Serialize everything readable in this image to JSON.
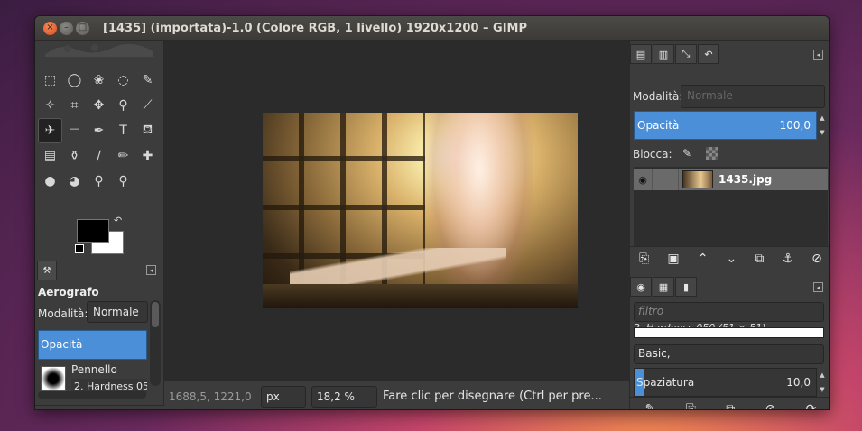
{
  "window": {
    "title": "[1435] (importata)-1.0 (Colore RGB, 1 livello) 1920x1200 – GIMP",
    "close_glyph": "×",
    "min_glyph": "–",
    "max_glyph": "□"
  },
  "toolbox": {
    "tools": [
      {
        "name": "rect-select-icon",
        "glyph": "⬚"
      },
      {
        "name": "ellipse-select-icon",
        "glyph": "◯"
      },
      {
        "name": "free-select-icon",
        "glyph": "❀"
      },
      {
        "name": "fuzzy-select-icon",
        "glyph": "◌"
      },
      {
        "name": "paths-icon",
        "glyph": "✎"
      },
      {
        "name": "magic-wand-icon",
        "glyph": "✧"
      },
      {
        "name": "crop-icon",
        "glyph": "⌗"
      },
      {
        "name": "move-icon",
        "glyph": "✥"
      },
      {
        "name": "color-picker-icon",
        "glyph": "⚲"
      },
      {
        "name": "paintbrush-icon",
        "glyph": "⟋"
      },
      {
        "name": "airbrush-icon",
        "glyph": "✈"
      },
      {
        "name": "eraser-icon",
        "glyph": "▭"
      },
      {
        "name": "ink-icon",
        "glyph": "✒"
      },
      {
        "name": "text-icon",
        "glyph": "T"
      },
      {
        "name": "bucket-fill-icon",
        "glyph": "⛾"
      },
      {
        "name": "gradient-icon",
        "glyph": "▤"
      },
      {
        "name": "clone-icon",
        "glyph": "⚱"
      },
      {
        "name": "smudge-icon",
        "glyph": "∕"
      },
      {
        "name": "pencil-icon",
        "glyph": "✏"
      },
      {
        "name": "heal-icon",
        "glyph": "✚"
      },
      {
        "name": "dodge-burn-icon",
        "glyph": "●"
      },
      {
        "name": "blur-icon",
        "glyph": "◕"
      },
      {
        "name": "zoom-icon",
        "glyph": "⚲"
      },
      {
        "name": "measure-icon",
        "glyph": "⚲"
      }
    ],
    "swap_glyph": "↶",
    "options_tab_glyph": "⚒",
    "panel_menu_glyph": "◂",
    "options": {
      "title": "Aerografo",
      "mode_label": "Modalità:",
      "mode_value": "Normale",
      "opacity_label": "Opacità",
      "brush_label": "Pennello",
      "brush_name": "2. Hardness 050"
    },
    "bottom_buttons": [
      {
        "name": "save-options-icon",
        "glyph": "⤓"
      },
      {
        "name": "restore-options-icon",
        "glyph": "⟲"
      },
      {
        "name": "delete-options-icon",
        "glyph": "⊘"
      },
      {
        "name": "reset-options-icon",
        "glyph": "⟳"
      }
    ]
  },
  "statusbar": {
    "coords": "1688,5, 1221,0",
    "unit": "px",
    "zoom": "18,2 %",
    "hint": "Fare clic per disegnare (Ctrl per pre..."
  },
  "dock": {
    "tabs": [
      {
        "name": "layers-tab-icon",
        "glyph": "▤"
      },
      {
        "name": "channels-tab-icon",
        "glyph": "▥"
      },
      {
        "name": "paths-tab-icon",
        "glyph": "⤡"
      },
      {
        "name": "undo-tab-icon",
        "glyph": "↶"
      }
    ],
    "mode_label": "Modalità:",
    "mode_value": "Normale",
    "opacity_label": "Opacità",
    "opacity_value": "100,0",
    "lock_label": "Blocca:",
    "layer": {
      "name": "1435.jpg"
    },
    "layer_buttons": [
      {
        "name": "new-layer-icon",
        "glyph": "⎘"
      },
      {
        "name": "new-group-icon",
        "glyph": "▣"
      },
      {
        "name": "raise-layer-icon",
        "glyph": "⌃"
      },
      {
        "name": "lower-layer-icon",
        "glyph": "⌄"
      },
      {
        "name": "duplicate-layer-icon",
        "glyph": "⧉"
      },
      {
        "name": "anchor-layer-icon",
        "glyph": "⚓"
      },
      {
        "name": "delete-layer-icon",
        "glyph": "⊘"
      }
    ],
    "brush_tabs": [
      {
        "name": "brushes-tab-icon",
        "glyph": "◉"
      },
      {
        "name": "patterns-tab-icon",
        "glyph": "▦"
      },
      {
        "name": "gradients-tab-icon",
        "glyph": "▮"
      }
    ],
    "filter_placeholder": "filtro",
    "brush_name": "2. Hardness 050 (51 × 51)",
    "brush_tag": "Basic,",
    "spacing_label": "Spaziatura",
    "spacing_value": "10,0",
    "brush_buttons": [
      {
        "name": "edit-brush-icon",
        "glyph": "✎"
      },
      {
        "name": "new-brush-icon",
        "glyph": "⎘"
      },
      {
        "name": "duplicate-brush-icon",
        "glyph": "⧉"
      },
      {
        "name": "delete-brush-icon",
        "glyph": "⊘"
      },
      {
        "name": "refresh-brushes-icon",
        "glyph": "⟳"
      }
    ]
  }
}
